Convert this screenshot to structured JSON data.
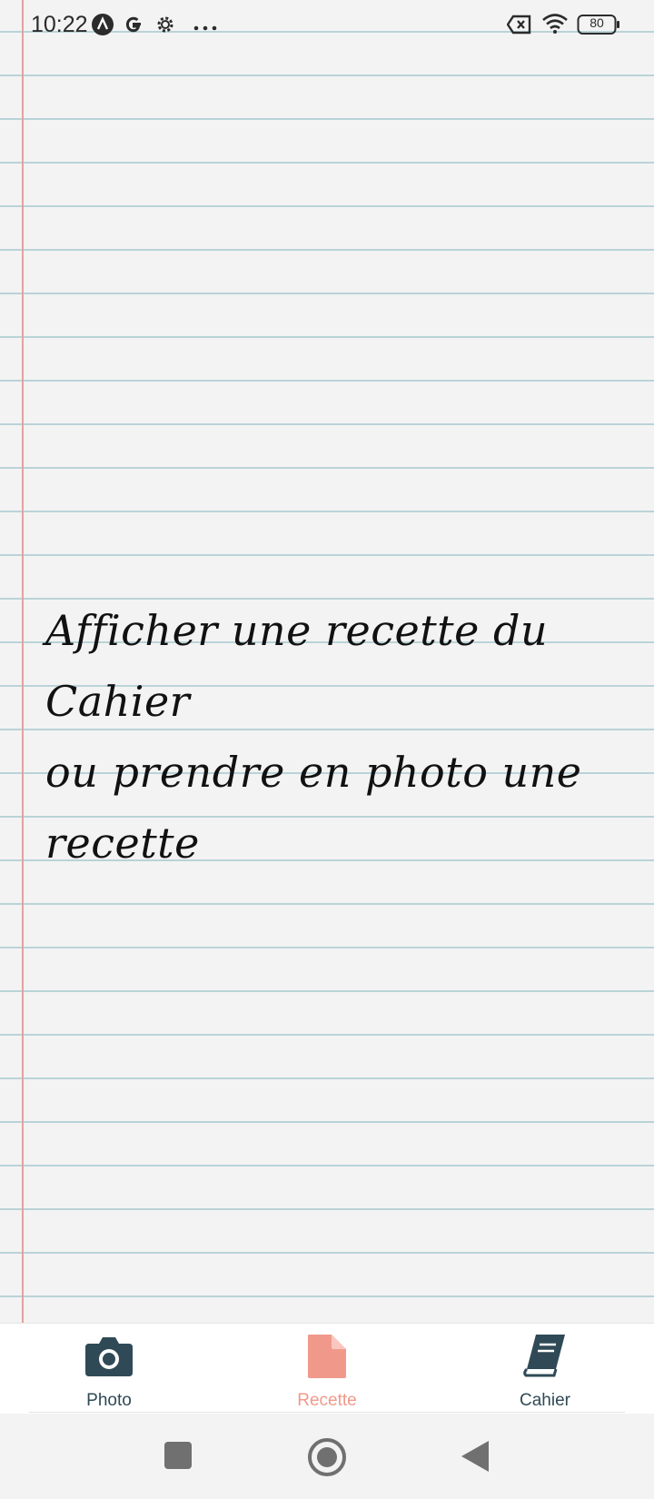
{
  "status_bar": {
    "time": "10:22",
    "battery_level": "80",
    "icons": [
      "app-a-icon",
      "google-icon",
      "settings-gear-icon",
      "more-dots-icon",
      "no-sim-icon",
      "wifi-icon",
      "battery-icon"
    ]
  },
  "message": {
    "line1": "Afficher une recette du Cahier",
    "line2": "ou prendre en photo une recette"
  },
  "bottom_nav": {
    "items": [
      {
        "label": "Photo",
        "icon": "camera-icon",
        "color": "#2f4a56",
        "active": false
      },
      {
        "label": "Recette",
        "icon": "document-icon",
        "color": "#f0998b",
        "active": true
      },
      {
        "label": "Cahier",
        "icon": "book-icon",
        "color": "#2f4a56",
        "active": false
      }
    ]
  },
  "system_nav": {
    "buttons": [
      "recents-square-button",
      "home-circle-button",
      "back-triangle-button"
    ]
  },
  "colors": {
    "paper": "#f3f3f3",
    "ruled_line": "#b9d3d8",
    "margin_line": "#e3a1a3",
    "accent": "#f0998b",
    "icon_dark": "#2f4a56"
  }
}
